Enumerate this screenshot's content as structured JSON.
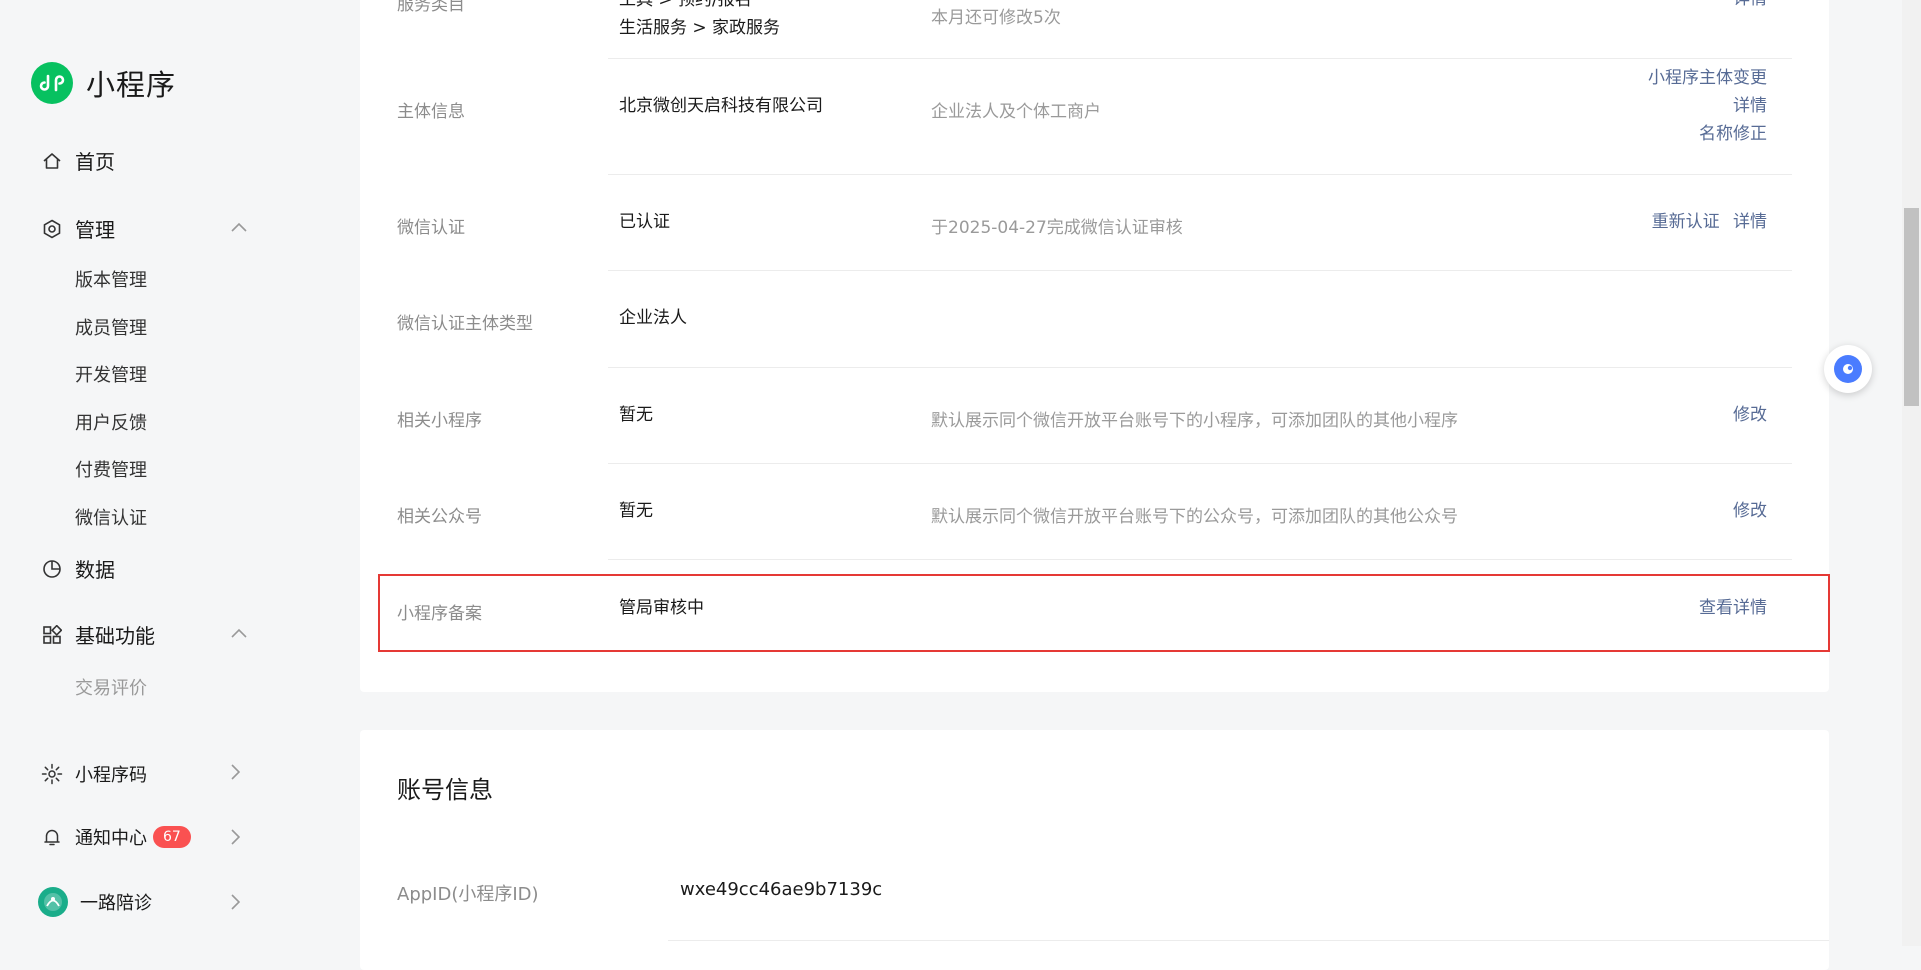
{
  "sidebar": {
    "app_name": "小程序",
    "home": "首页",
    "manage": "管理",
    "manage_sub": [
      "版本管理",
      "成员管理",
      "开发管理",
      "用户反馈",
      "付费管理",
      "微信认证"
    ],
    "data": "数据",
    "basic": "基础功能",
    "basic_sub": [
      "交易评价"
    ],
    "miniprogram_code": "小程序码",
    "notifications": "通知中心",
    "notifications_count": "67",
    "account_name": "一路陪诊"
  },
  "settings": {
    "service_category": {
      "label": "服务类目",
      "value_line1": "工具 > 预约/报名",
      "value_line2": "生活服务 > 家政服务",
      "desc": "本月还可修改5次",
      "action": "详情"
    },
    "entity_info": {
      "label": "主体信息",
      "value": "北京微创天启科技有限公司",
      "desc": "企业法人及个体工商户",
      "actions": [
        "小程序主体变更",
        "详情",
        "名称修正"
      ]
    },
    "wechat_verify": {
      "label": "微信认证",
      "value": "已认证",
      "desc": "于2025-04-27完成微信认证审核",
      "actions": [
        "重新认证",
        "详情"
      ]
    },
    "verify_entity_type": {
      "label": "微信认证主体类型",
      "value": "企业法人"
    },
    "related_miniprograms": {
      "label": "相关小程序",
      "value": "暂无",
      "desc": "默认展示同个微信开放平台账号下的小程序，可添加团队的其他小程序",
      "action": "修改"
    },
    "related_official_accounts": {
      "label": "相关公众号",
      "value": "暂无",
      "desc": "默认展示同个微信开放平台账号下的公众号，可添加团队的其他公众号",
      "action": "修改"
    },
    "filing": {
      "label": "小程序备案",
      "value": "管局审核中",
      "action": "查看详情"
    }
  },
  "account_info": {
    "title": "账号信息",
    "appid_label": "AppID(小程序ID)",
    "appid_value": "wxe49cc46ae9b7139c"
  },
  "colors": {
    "brand": "#07c160",
    "link": "#576b95",
    "highlight": "#e53935",
    "badge": "#fa5151"
  }
}
